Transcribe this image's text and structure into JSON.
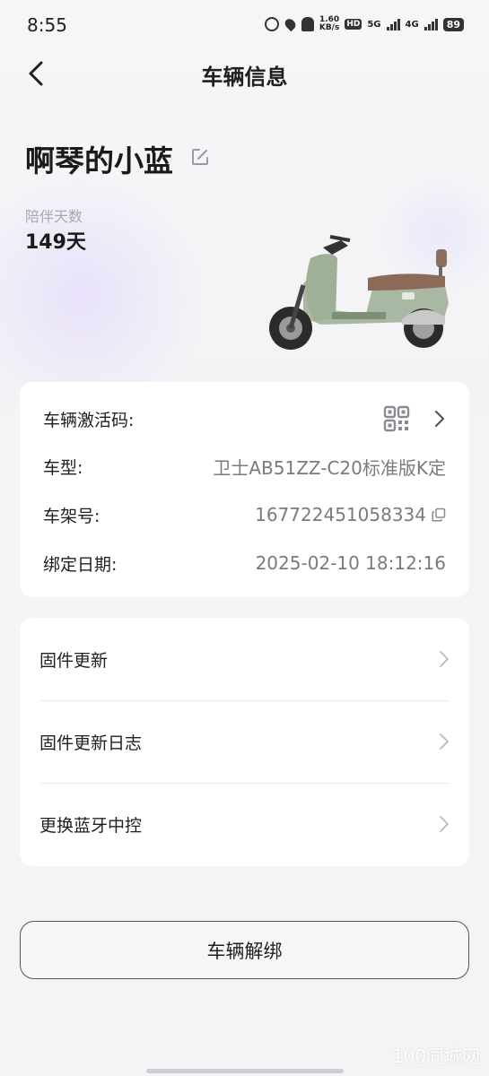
{
  "status_bar": {
    "time": "8:55",
    "net_speed_value": "1.60",
    "net_speed_unit": "KB/s",
    "hd_badge": "HD",
    "net_5g": "5G",
    "net_4g": "4G",
    "battery": "89"
  },
  "nav": {
    "title": "车辆信息",
    "back_icon": "chevron-left-icon"
  },
  "vehicle": {
    "name": "啊琴的小蓝",
    "days_label": "陪伴天数",
    "days_value": "149天"
  },
  "info": {
    "activation_label": "车辆激活码:",
    "model_label": "车型:",
    "model_value": "卫士AB51ZZ-C20标准版K定",
    "frame_label": "车架号:",
    "frame_value": "167722451058334",
    "bind_date_label": "绑定日期:",
    "bind_date_value": "2025-02-10 18:12:16"
  },
  "menu": {
    "items": [
      {
        "label": "固件更新"
      },
      {
        "label": "固件更新日志"
      },
      {
        "label": "更换蓝牙中控"
      }
    ]
  },
  "unbind_button": "车辆解绑",
  "watermark": "100同城网",
  "colors": {
    "background": "#f4f4f6",
    "card": "#ffffff",
    "text_primary": "#1f1f1f",
    "text_secondary": "#7a7a80",
    "scooter_body": "#a9b8a2"
  }
}
